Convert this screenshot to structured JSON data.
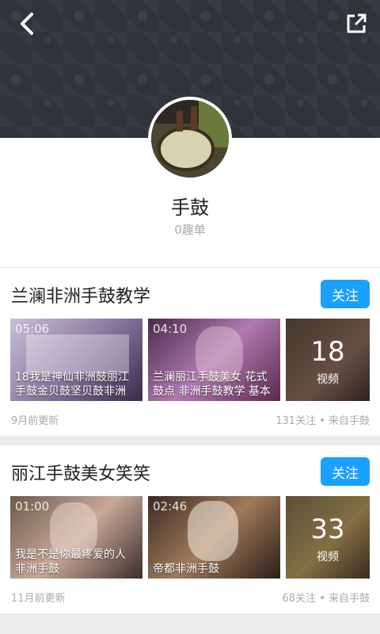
{
  "header": {
    "back_icon": "chevron-left-icon",
    "share_icon": "share-external-icon"
  },
  "profile": {
    "name": "手鼓",
    "subtitle": "0趣单"
  },
  "cards": [
    {
      "title": "兰澜非洲手鼓教学",
      "follow_label": "关注",
      "videos": [
        {
          "duration": "05:06",
          "caption": "18我是神仙非洲鼓丽江手鼓金贝鼓坚贝鼓非洲"
        },
        {
          "duration": "04:10",
          "caption": "兰澜丽江手鼓美女 花式鼓点 非洲手鼓教学 基本"
        }
      ],
      "count": "18",
      "count_label": "视频",
      "updated": "9月前更新",
      "meta": "131关注 • 来自手鼓"
    },
    {
      "title": "丽江手鼓美女笑笑",
      "follow_label": "关注",
      "videos": [
        {
          "duration": "01:00",
          "caption": "我是不是你最疼爱的人 非洲手鼓"
        },
        {
          "duration": "02:46",
          "caption": "帝都非洲手鼓"
        }
      ],
      "count": "33",
      "count_label": "视频",
      "updated": "11月前更新",
      "meta": "68关注 • 来自手鼓"
    }
  ],
  "colors": {
    "accent": "#1aa0ff",
    "header_bg": "#2f343b"
  }
}
